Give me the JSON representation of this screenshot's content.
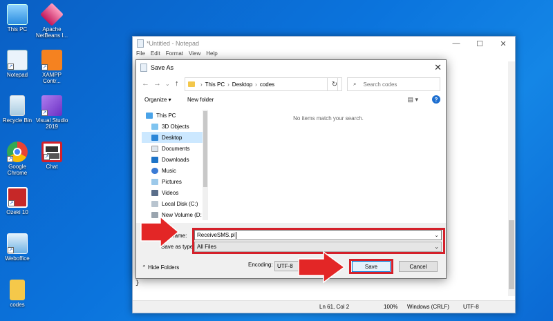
{
  "desktop": {
    "icons": [
      {
        "label": "This PC"
      },
      {
        "label": "Apache NetBeans I..."
      },
      {
        "label": "Notepad"
      },
      {
        "label": "XAMPP Contr..."
      },
      {
        "label": "Recycle Bin"
      },
      {
        "label": "Visual Studio 2019"
      },
      {
        "label": "Google Chrome"
      },
      {
        "label": "Chat"
      },
      {
        "label": "Ozeki 10"
      },
      {
        "label": "Weboffice"
      },
      {
        "label": "codes"
      }
    ]
  },
  "notepad": {
    "title": "*Untitled - Notepad",
    "menu": [
      "File",
      "Edit",
      "Format",
      "View",
      "Help"
    ],
    "text": "}",
    "status": {
      "position": "Ln 61, Col 2",
      "zoom": "100%",
      "line_ending": "Windows (CRLF)",
      "encoding": "UTF-8"
    }
  },
  "dialog": {
    "title": "Save As",
    "path": [
      "This PC",
      "Desktop",
      "codes"
    ],
    "search_placeholder": "Search codes",
    "organize": "Organize ▾",
    "new_folder": "New folder",
    "nav_items": [
      "This PC",
      "3D Objects",
      "Desktop",
      "Documents",
      "Downloads",
      "Music",
      "Pictures",
      "Videos",
      "Local Disk (C:)",
      "New Volume (D:"
    ],
    "empty_message": "No items match your search.",
    "file_name_label": "File name:",
    "file_name_value": "ReceiveSMS.pl",
    "save_type_label": "Save as type:",
    "save_type_value": "All Files",
    "hide_folders": "Hide Folders",
    "encoding_label": "Encoding:",
    "encoding_value": "UTF-8",
    "save_label": "Save",
    "cancel_label": "Cancel"
  },
  "colors": {
    "accent": "#d4202a",
    "selection": "#cce8ff",
    "desktop": "#0b74dd"
  }
}
